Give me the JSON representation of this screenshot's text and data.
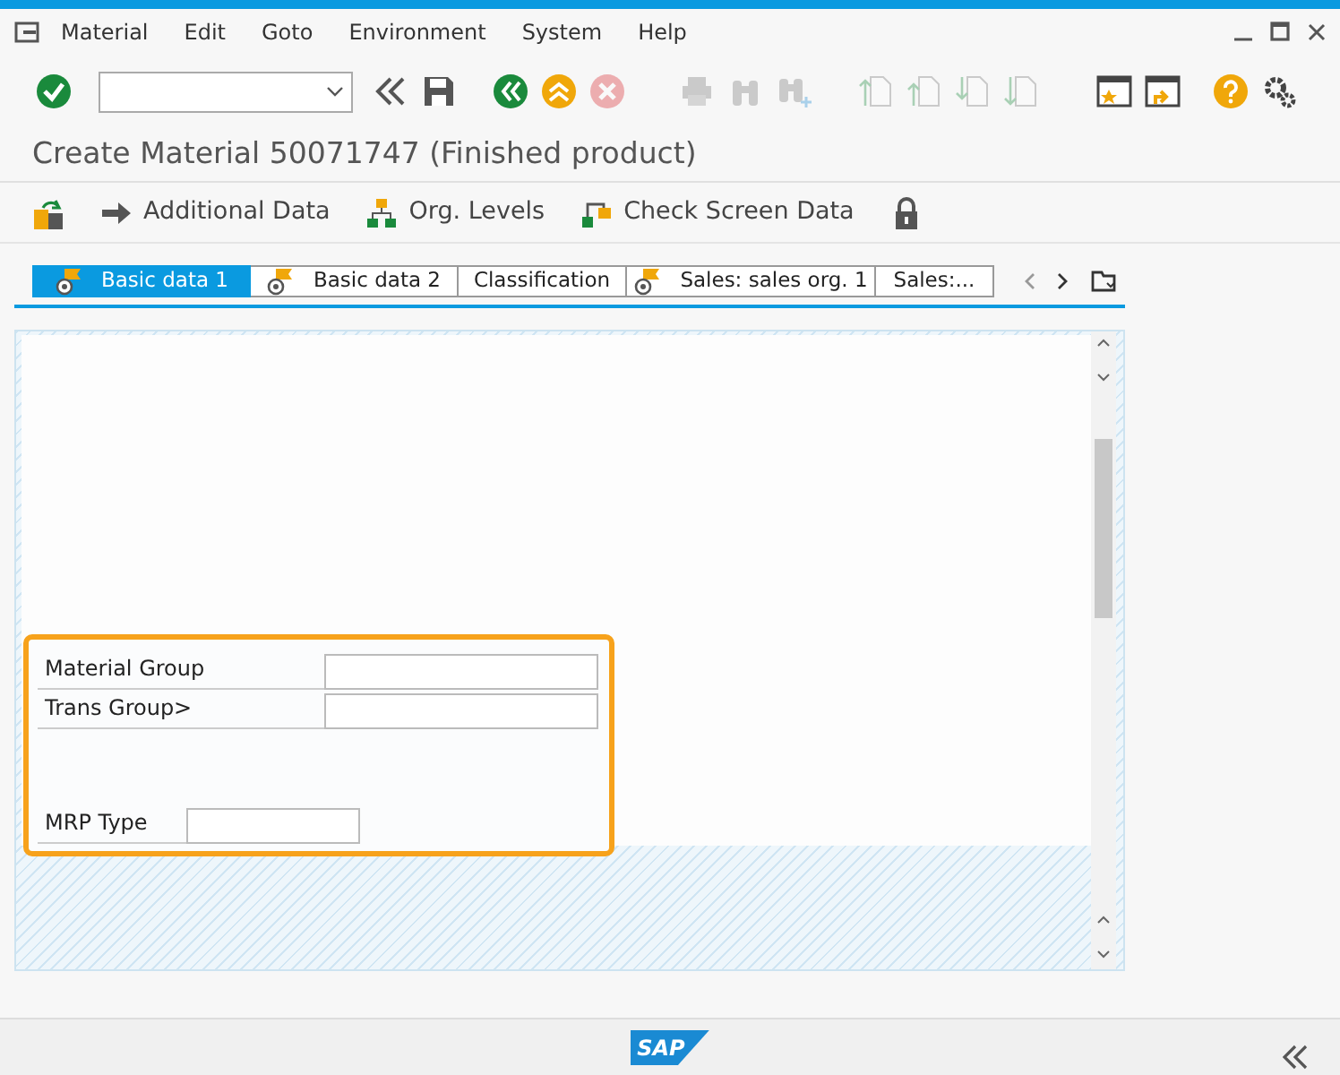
{
  "menu_bar": {
    "items": [
      {
        "label": "Material"
      },
      {
        "label": "Edit"
      },
      {
        "label": "Goto"
      },
      {
        "label": "Environment"
      },
      {
        "label": "System"
      },
      {
        "label": "Help"
      }
    ]
  },
  "toolbar": [
    {
      "kind": "enter",
      "disabled": false
    },
    {
      "kind": "command-field",
      "disabled": false
    },
    {
      "kind": "collapse",
      "disabled": false
    },
    {
      "kind": "save",
      "disabled": false
    },
    {
      "kind": "back",
      "disabled": false
    },
    {
      "kind": "exit",
      "disabled": false
    },
    {
      "kind": "cancel",
      "disabled": true
    },
    {
      "kind": "print",
      "disabled": true
    },
    {
      "kind": "find",
      "disabled": true
    },
    {
      "kind": "find-next",
      "disabled": true
    },
    {
      "kind": "first-page",
      "disabled": true
    },
    {
      "kind": "previous-page",
      "disabled": true
    },
    {
      "kind": "next-page",
      "disabled": true
    },
    {
      "kind": "last-page",
      "disabled": true
    },
    {
      "kind": "new-session",
      "disabled": false
    },
    {
      "kind": "shortcut",
      "disabled": false
    },
    {
      "kind": "help",
      "disabled": false
    },
    {
      "kind": "settings",
      "disabled": false
    }
  ],
  "title": "Create Material 50071747 (Finished product)",
  "app_toolbar": [
    {
      "kind": "switch"
    },
    {
      "kind": "arrow",
      "label": "Additional Data"
    },
    {
      "kind": "hierarchy",
      "label": "Org. Levels"
    },
    {
      "kind": "check",
      "label": "Check Screen Data"
    },
    {
      "kind": "lock"
    }
  ],
  "tabs": [
    {
      "label": "Basic data 1",
      "selected": true,
      "status_icon": true
    },
    {
      "label": "Basic data 2",
      "selected": false,
      "status_icon": true
    },
    {
      "label": "Classification",
      "selected": false,
      "status_icon": false
    },
    {
      "label": "Sales: sales org. 1",
      "selected": false,
      "status_icon": true
    },
    {
      "label": "Sales:...",
      "selected": false,
      "status_icon": false
    }
  ],
  "group": {
    "rows": [
      {
        "label": "Material Group",
        "kind": "wide"
      },
      {
        "label": "Trans Group>",
        "kind": "wide"
      },
      {
        "label": "MRP Type",
        "kind": "narrow"
      }
    ]
  },
  "footer": {
    "logo": "SAP"
  }
}
